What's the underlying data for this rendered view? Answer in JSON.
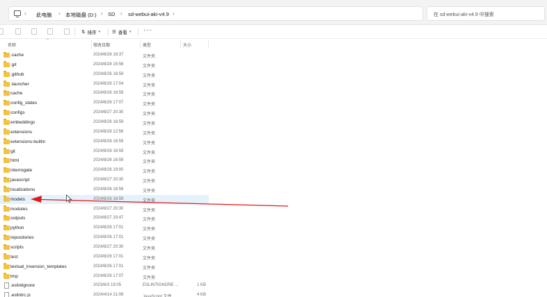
{
  "address_bar": {
    "breadcrumbs": [
      "此电脑",
      "本地磁盘 (D:)",
      "SD",
      "sd-webui-aki-v4.9"
    ],
    "search_placeholder": "在 sd-webui-aki-v4.9 中搜索"
  },
  "toolbar": {
    "sort_label": "排序",
    "view_label": "查看",
    "more_label": "···"
  },
  "columns": {
    "name": "名称",
    "date": "修改日期",
    "type": "类型",
    "size": "大小"
  },
  "files": [
    {
      "name": ".cache",
      "date": "2024/8/26 18:37",
      "type": "文件夹",
      "size": "",
      "kind": "folder"
    },
    {
      "name": ".git",
      "date": "2024/8/28 15:56",
      "type": "文件夹",
      "size": "",
      "kind": "folder"
    },
    {
      "name": ".github",
      "date": "2024/8/26 16:59",
      "type": "文件夹",
      "size": "",
      "kind": "folder"
    },
    {
      "name": ".launcher",
      "date": "2024/8/26 17:04",
      "type": "文件夹",
      "size": "",
      "kind": "folder"
    },
    {
      "name": "cache",
      "date": "2024/8/26 16:59",
      "type": "文件夹",
      "size": "",
      "kind": "folder"
    },
    {
      "name": "config_states",
      "date": "2024/8/26 17:07",
      "type": "文件夹",
      "size": "",
      "kind": "folder"
    },
    {
      "name": "configs",
      "date": "2024/8/27 20:30",
      "type": "文件夹",
      "size": "",
      "kind": "folder"
    },
    {
      "name": "embeddings",
      "date": "2024/8/26 16:59",
      "type": "文件夹",
      "size": "",
      "kind": "folder"
    },
    {
      "name": "extensions",
      "date": "2024/8/28 12:56",
      "type": "文件夹",
      "size": "",
      "kind": "folder"
    },
    {
      "name": "extensions-builtin",
      "date": "2024/8/26 16:59",
      "type": "文件夹",
      "size": "",
      "kind": "folder"
    },
    {
      "name": "git",
      "date": "2024/8/26 16:59",
      "type": "文件夹",
      "size": "",
      "kind": "folder"
    },
    {
      "name": "html",
      "date": "2024/8/26 16:59",
      "type": "文件夹",
      "size": "",
      "kind": "folder"
    },
    {
      "name": "interrogate",
      "date": "2024/8/26 19:00",
      "type": "文件夹",
      "size": "",
      "kind": "folder"
    },
    {
      "name": "javascript",
      "date": "2024/8/27 20:30",
      "type": "文件夹",
      "size": "",
      "kind": "folder"
    },
    {
      "name": "localizations",
      "date": "2024/8/26 16:59",
      "type": "文件夹",
      "size": "",
      "kind": "folder"
    },
    {
      "name": "models",
      "date": "2024/8/26 16:59",
      "type": "文件夹",
      "size": "",
      "kind": "folder",
      "selected": true
    },
    {
      "name": "modules",
      "date": "2024/8/27 20:30",
      "type": "文件夹",
      "size": "",
      "kind": "folder"
    },
    {
      "name": "outputs",
      "date": "2024/8/27 20:47",
      "type": "文件夹",
      "size": "",
      "kind": "folder"
    },
    {
      "name": "python",
      "date": "2024/8/26 17:01",
      "type": "文件夹",
      "size": "",
      "kind": "folder"
    },
    {
      "name": "repositories",
      "date": "2024/8/26 17:01",
      "type": "文件夹",
      "size": "",
      "kind": "folder"
    },
    {
      "name": "scripts",
      "date": "2024/8/27 20:30",
      "type": "文件夹",
      "size": "",
      "kind": "folder"
    },
    {
      "name": "test",
      "date": "2024/8/26 17:01",
      "type": "文件夹",
      "size": "",
      "kind": "folder"
    },
    {
      "name": "textual_inversion_templates",
      "date": "2024/8/26 17:01",
      "type": "文件夹",
      "size": "",
      "kind": "folder"
    },
    {
      "name": "tmp",
      "date": "2024/8/26 17:07",
      "type": "文件夹",
      "size": "",
      "kind": "folder"
    },
    {
      "name": ".eslintignore",
      "date": "2023/6/3 19:05",
      "type": "ESLINTIGNORE ...",
      "size": "1 KB",
      "kind": "file"
    },
    {
      "name": ".eslintrc.js",
      "date": "2024/4/14 21:09",
      "type": "JavaScript 文件",
      "size": "4 KB",
      "kind": "file"
    }
  ],
  "colors": {
    "selection": "#e5f1fb",
    "folder": "#f2c33f",
    "annotation_arrow": "#e01818"
  }
}
